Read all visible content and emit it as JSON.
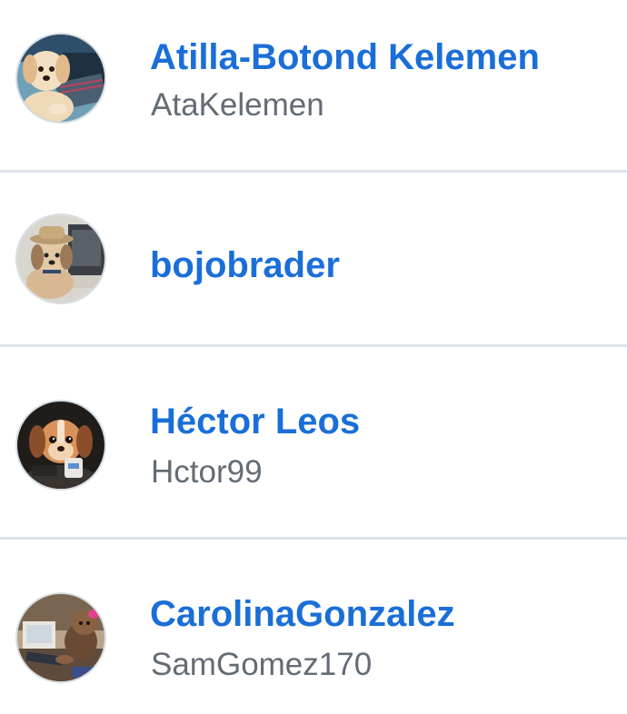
{
  "users": [
    {
      "display_name": "Atilla-Botond Kelemen",
      "username": "AtaKelemen",
      "avatar_icon": "puppy-at-keyboard-avatar"
    },
    {
      "display_name": "bojobrader",
      "username": "",
      "avatar_icon": "puppy-with-hat-at-laptop-avatar"
    },
    {
      "display_name": "Héctor Leos",
      "username": "Hctor99",
      "avatar_icon": "puppy-with-coffee-avatar"
    },
    {
      "display_name": "CarolinaGonzalez",
      "username": "SamGomez170",
      "avatar_icon": "dog-at-computer-desk-avatar"
    }
  ],
  "colors": {
    "link": "#1a6ed8",
    "secondary_text": "#636c76",
    "divider": "#dfe4e9"
  }
}
